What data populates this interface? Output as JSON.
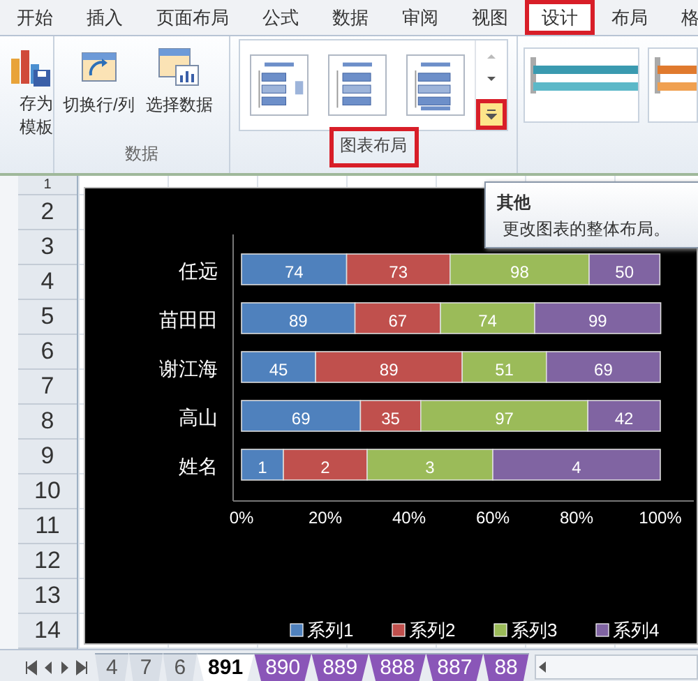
{
  "ribbon_tabs": [
    {
      "label": "开始",
      "selected": false,
      "highlighted": false
    },
    {
      "label": "插入",
      "selected": false,
      "highlighted": false
    },
    {
      "label": "页面布局",
      "selected": false,
      "highlighted": false
    },
    {
      "label": "公式",
      "selected": false,
      "highlighted": false
    },
    {
      "label": "数据",
      "selected": false,
      "highlighted": false
    },
    {
      "label": "审阅",
      "selected": false,
      "highlighted": false
    },
    {
      "label": "视图",
      "selected": false,
      "highlighted": false
    },
    {
      "label": "设计",
      "selected": true,
      "highlighted": true
    },
    {
      "label": "布局",
      "selected": false,
      "highlighted": false
    },
    {
      "label": "格",
      "selected": false,
      "highlighted": false
    }
  ],
  "ribbon": {
    "save_template": {
      "lines": [
        "存为",
        "模板"
      ]
    },
    "data_group": {
      "buttons": [
        {
          "label": "切换行/列",
          "kind": "switch"
        },
        {
          "label": "选择数据",
          "kind": "select"
        }
      ],
      "label": "数据"
    },
    "layout_group": {
      "label": "图表布局",
      "label_highlighted": true,
      "more_button_highlighted": true
    }
  },
  "tooltip": {
    "title": "其他",
    "text": "更改图表的整体布局。"
  },
  "rows": [
    "1",
    "2",
    "3",
    "4",
    "5",
    "6",
    "7",
    "8",
    "9",
    "10",
    "11",
    "12",
    "13",
    "14"
  ],
  "chart": {
    "bar_labels": [
      [
        "74",
        "73",
        "98",
        "50"
      ],
      [
        "89",
        "67",
        "74",
        "99"
      ],
      [
        "45",
        "89",
        "51",
        "69"
      ],
      [
        "69",
        "35",
        "97",
        "42"
      ],
      [
        "1",
        "2",
        "3",
        "4"
      ]
    ],
    "chart_data": {
      "type": "bar",
      "orientation": "horizontal",
      "stacked": true,
      "categories": [
        "任远",
        "苗田田",
        "谢江海",
        "高山",
        "姓名"
      ],
      "series": [
        {
          "name": "系列1",
          "color": "#4f81bd",
          "values": [
            25.1,
            27.1,
            17.7,
            28.4,
            10
          ]
        },
        {
          "name": "系列2",
          "color": "#c0504d",
          "values": [
            24.7,
            20.4,
            35.0,
            14.4,
            20
          ]
        },
        {
          "name": "系列3",
          "color": "#9bbb59",
          "values": [
            33.2,
            22.5,
            20.1,
            39.9,
            30
          ]
        },
        {
          "name": "系列4",
          "color": "#8064a2",
          "values": [
            16.9,
            30.1,
            27.2,
            17.3,
            40
          ]
        }
      ],
      "xlim": [
        0,
        100
      ],
      "legend": "bottom",
      "xticks": [
        {
          "value": 0,
          "label": "0%"
        },
        {
          "value": 20,
          "label": "20%"
        },
        {
          "value": 40,
          "label": "40%"
        },
        {
          "value": 60,
          "label": "60%"
        },
        {
          "value": 80,
          "label": "80%"
        },
        {
          "value": 100,
          "label": "100%"
        }
      ]
    }
  },
  "sheet_tabs": [
    {
      "label": "4",
      "selected": false
    },
    {
      "label": "7",
      "selected": false
    },
    {
      "label": "6",
      "selected": false
    },
    {
      "label": "891",
      "selected": true
    },
    {
      "label": "890",
      "selected": false,
      "color": "#8a56b8"
    },
    {
      "label": "889",
      "selected": false,
      "color": "#8a56b8"
    },
    {
      "label": "888",
      "selected": false,
      "color": "#8a56b8"
    },
    {
      "label": "887",
      "selected": false,
      "color": "#8a56b8"
    },
    {
      "label": "88",
      "selected": false,
      "color": "#8a56b8"
    }
  ]
}
